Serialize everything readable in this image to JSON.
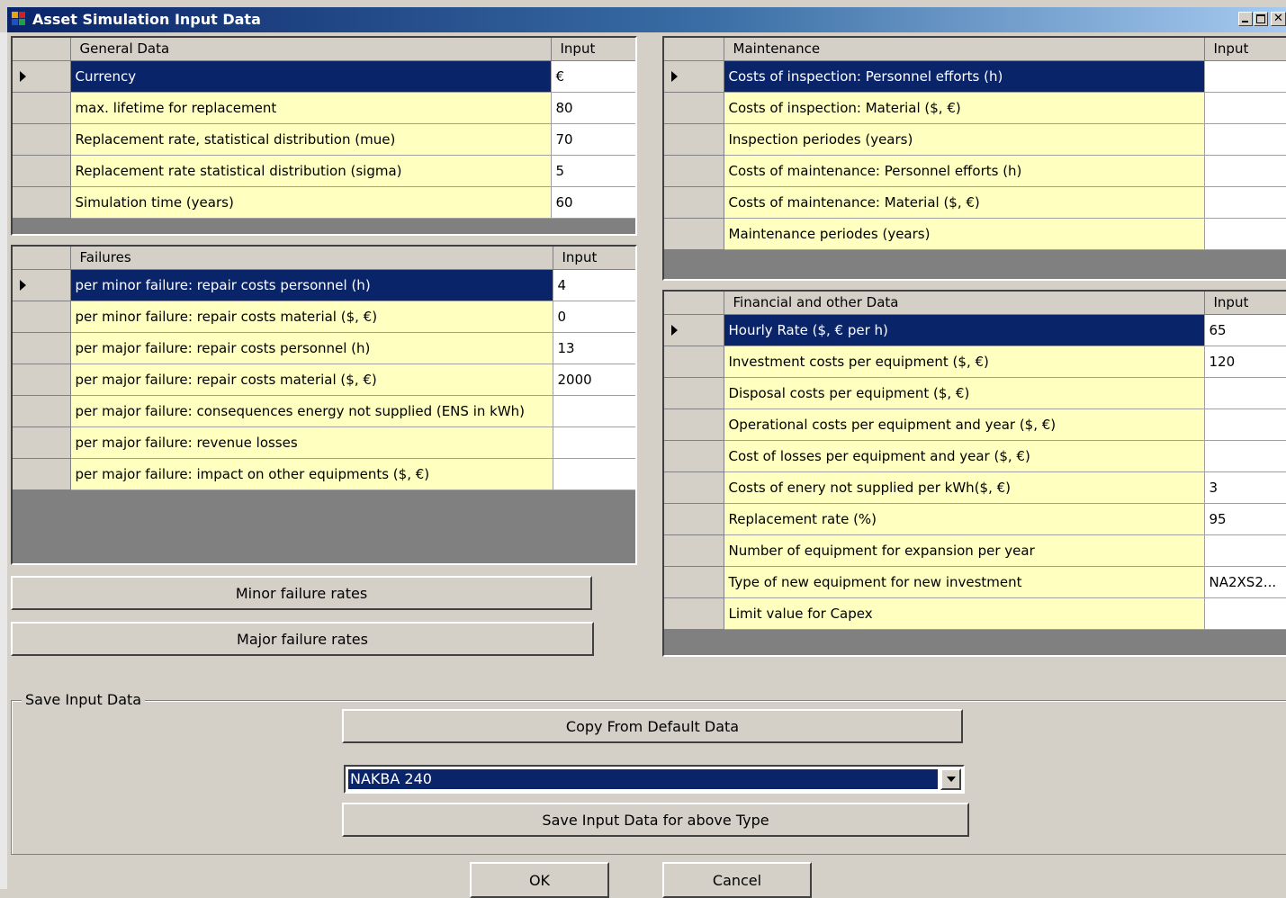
{
  "window": {
    "title": "Asset Simulation Input Data"
  },
  "general": {
    "header_label": "General Data",
    "header_input": "Input",
    "rows": [
      {
        "label": "Currency",
        "value": "€"
      },
      {
        "label": "max. lifetime for replacement",
        "value": "80"
      },
      {
        "label": "Replacement rate, statistical distribution (mue)",
        "value": "70"
      },
      {
        "label": "Replacement rate statistical distribution (sigma)",
        "value": "5"
      },
      {
        "label": "Simulation time (years)",
        "value": "60"
      }
    ]
  },
  "failures": {
    "header_label": "Failures",
    "header_input": "Input",
    "rows": [
      {
        "label": "per minor failure: repair costs personnel (h)",
        "value": "4"
      },
      {
        "label": "per minor failure: repair costs material ($, €)",
        "value": "0"
      },
      {
        "label": "per major failure: repair costs personnel (h)",
        "value": "13"
      },
      {
        "label": "per major failure: repair costs material ($, €)",
        "value": "2000"
      },
      {
        "label": "per major failure: consequences energy not supplied (ENS in kWh)",
        "value": ""
      },
      {
        "label": "per major failure: revenue losses",
        "value": ""
      },
      {
        "label": "per major failure: impact on other equipments ($, €)",
        "value": ""
      }
    ]
  },
  "maintenance": {
    "header_label": "Maintenance",
    "header_input": "Input",
    "rows": [
      {
        "label": "Costs of inspection: Personnel efforts (h)",
        "value": ""
      },
      {
        "label": "Costs of inspection: Material ($, €)",
        "value": ""
      },
      {
        "label": "Inspection periodes (years)",
        "value": ""
      },
      {
        "label": "Costs of maintenance: Personnel efforts (h)",
        "value": ""
      },
      {
        "label": "Costs of maintenance: Material ($, €)",
        "value": ""
      },
      {
        "label": "Maintenance periodes (years)",
        "value": ""
      }
    ]
  },
  "financial": {
    "header_label": "Financial and other Data",
    "header_input": "Input",
    "rows": [
      {
        "label": "Hourly Rate ($, € per h)",
        "value": "65"
      },
      {
        "label": "Investment costs per equipment ($, €)",
        "value": "120"
      },
      {
        "label": "Disposal costs per equipment ($, €)",
        "value": ""
      },
      {
        "label": "Operational costs per equipment and year ($, €)",
        "value": ""
      },
      {
        "label": "Cost of losses per equipment and year ($, €)",
        "value": ""
      },
      {
        "label": "Costs of enery not supplied per kWh($, €)",
        "value": "3"
      },
      {
        "label": "Replacement rate (%)",
        "value": "95"
      },
      {
        "label": "Number of equipment for expansion per year",
        "value": ""
      },
      {
        "label": "Type of new equipment for new investment",
        "value": "NA2XS2..."
      },
      {
        "label": "Limit value for Capex",
        "value": ""
      }
    ]
  },
  "buttons": {
    "minor_failure_rates": "Minor failure rates",
    "major_failure_rates": "Major failure rates",
    "copy_default": "Copy From Default Data",
    "save_type": "Save Input Data for above Type",
    "ok": "OK",
    "cancel": "Cancel"
  },
  "save_group": {
    "label": "Save Input Data",
    "type_selected": "NAKBA 240"
  },
  "colors": {
    "selection": "#0a246a",
    "label_cell": "#ffffc0",
    "face": "#d4d0c8",
    "grid_background": "#808080"
  }
}
